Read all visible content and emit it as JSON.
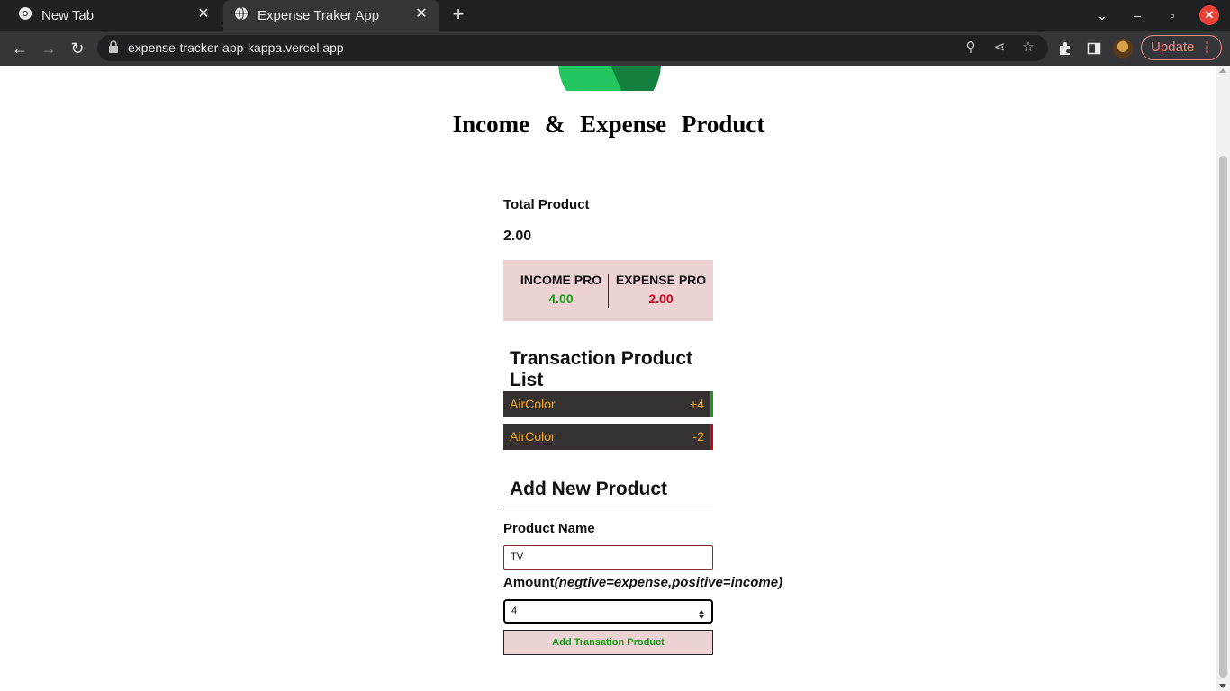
{
  "browser": {
    "tabs": [
      {
        "title": "New Tab",
        "active": false
      },
      {
        "title": "Expense Traker App",
        "active": true
      }
    ],
    "url": "expense-tracker-app-kappa.vercel.app",
    "update_label": "Update"
  },
  "page": {
    "title": "Income & Expense Product",
    "total_label": "Total Product",
    "total_value": "2.00",
    "income_label": "INCOME PRO",
    "income_value": "4.00",
    "expense_label": "EXPENSE PRO",
    "expense_value": "2.00",
    "list_title": "Transaction Product List",
    "transactions": [
      {
        "name": "AirColor",
        "amount": "+4"
      },
      {
        "name": "AirColor",
        "amount": "-2"
      }
    ],
    "form_title": "Add New Product",
    "name_label": "Product Name",
    "name_value": "TV",
    "amount_label": "Amount",
    "amount_hint": "(negtive=expense,positive=income)",
    "amount_value": "4",
    "submit_label": "Add Transation Product"
  },
  "colors": {
    "income": "#1a9a1a",
    "expense": "#d0021b",
    "item_text": "#f5a623",
    "summary_bg": "#ecd2d3",
    "logo_green": "#22c55e",
    "logo_dark_green": "#15803d"
  }
}
